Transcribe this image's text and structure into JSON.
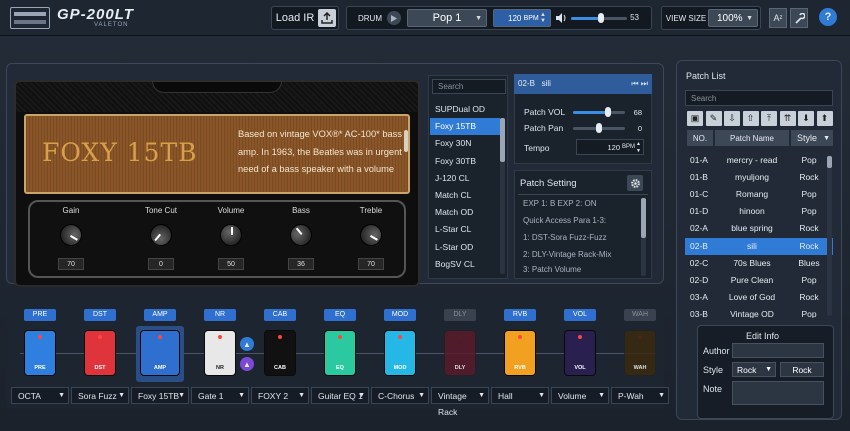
{
  "app": {
    "logo": "GP-200LT",
    "logo_sub": "VALETON"
  },
  "top": {
    "load_ir": "Load IR",
    "drum": "DRUM",
    "pattern": "Pop 1",
    "bpm": "120",
    "bpm_unit": "BPM",
    "volume": "53",
    "volume_level": 0.53,
    "view_size_label": "VIEW SIZE",
    "view_size": "100%",
    "help": "?"
  },
  "amp": {
    "name": "FOXY 15TB",
    "description": "Based on vintage VOX®* AC-100* bass amp. In 1963, the Beatles was in urgent need of a bass speaker with a volume",
    "knobs": [
      {
        "label": "Gain",
        "value": "70"
      },
      {
        "label": "Tone Cut",
        "value": "0"
      },
      {
        "label": "Volume",
        "value": "50"
      },
      {
        "label": "Bass",
        "value": "36"
      },
      {
        "label": "Treble",
        "value": "70"
      }
    ]
  },
  "amp_list": {
    "search_placeholder": "Search",
    "items": [
      "SUPDual OD",
      "Foxy 15TB",
      "Foxy 30N",
      "Foxy 30TB",
      "J-120 CL",
      "Match CL",
      "Match OD",
      "L-Star CL",
      "L-Star OD",
      "BogSV CL"
    ],
    "selected": 1
  },
  "patch": {
    "id": "02-B",
    "name": "sili",
    "vol_label": "Patch VOL",
    "vol": "68",
    "vol_level": 0.68,
    "pan_label": "Patch Pan",
    "pan": "0",
    "tempo_label": "Tempo",
    "tempo": "120",
    "tempo_unit": "BPM"
  },
  "patch_setting": {
    "title": "Patch Setting",
    "lines": [
      "EXP 1: B   EXP 2: ON",
      "Quick Access Para 1-3:",
      "1: DST-Sora Fuzz-Fuzz",
      "2: DLY-Vintage Rack-Mix",
      "3: Patch Volume"
    ]
  },
  "chain": {
    "slots": [
      {
        "label": "PRE",
        "pedal": "PRE",
        "module": "OCTA",
        "color": "#2e7fe0",
        "active": true
      },
      {
        "label": "DST",
        "pedal": "DST",
        "module": "Sora Fuzz",
        "color": "#e0343c",
        "active": true
      },
      {
        "label": "AMP",
        "pedal": "AMP",
        "module": "Foxy 15TB",
        "color": "#2e6fd0",
        "active": true
      },
      {
        "label": "NR",
        "pedal": "NR",
        "module": "Gate 1",
        "color": "#e8e8e8",
        "active": true
      },
      {
        "label": "CAB",
        "pedal": "CAB",
        "module": "FOXY 2",
        "color": "#111111",
        "active": true
      },
      {
        "label": "EQ",
        "pedal": "EQ",
        "module": "Guitar EQ 1",
        "color": "#2ac9a0",
        "active": true
      },
      {
        "label": "MOD",
        "pedal": "MOD",
        "module": "C-Chorus",
        "color": "#25b7e6",
        "active": true
      },
      {
        "label": "DLY",
        "pedal": "DLY",
        "module": "Vintage Rack",
        "color": "#5a1a2a",
        "active": false
      },
      {
        "label": "RVB",
        "pedal": "RVB",
        "module": "Hall",
        "color": "#f2a020",
        "active": true
      },
      {
        "label": "VOL",
        "pedal": "VOL",
        "module": "Volume",
        "color": "#2a2050",
        "active": true
      },
      {
        "label": "WAH",
        "pedal": "WAH",
        "module": "P-Wah",
        "color": "#3a2a10",
        "active": false
      }
    ]
  },
  "patch_list": {
    "title": "Patch List",
    "search_placeholder": "Search",
    "col_no": "NO.",
    "col_name": "Patch Name",
    "col_style": "Style",
    "rows": [
      {
        "no": "01-A",
        "name": "mercry - read",
        "style": "Pop"
      },
      {
        "no": "01-B",
        "name": "myuljong",
        "style": "Rock"
      },
      {
        "no": "01-C",
        "name": "Romang",
        "style": "Pop"
      },
      {
        "no": "01-D",
        "name": "hinoon",
        "style": "Pop"
      },
      {
        "no": "02-A",
        "name": "blue spring",
        "style": "Rock"
      },
      {
        "no": "02-B",
        "name": "sili",
        "style": "Rock"
      },
      {
        "no": "02-C",
        "name": "70s Blues",
        "style": "Blues"
      },
      {
        "no": "02-D",
        "name": "Pure Clean",
        "style": "Pop"
      },
      {
        "no": "03-A",
        "name": "Love of God",
        "style": "Rock"
      },
      {
        "no": "03-B",
        "name": "Vintage OD",
        "style": "Pop"
      }
    ],
    "selected": 5
  },
  "edit_info": {
    "title": "Edit Info",
    "author_label": "Author",
    "author": "",
    "style_label": "Style",
    "style_select": "Rock",
    "style_value": "Rock",
    "note_label": "Note",
    "note": ""
  }
}
